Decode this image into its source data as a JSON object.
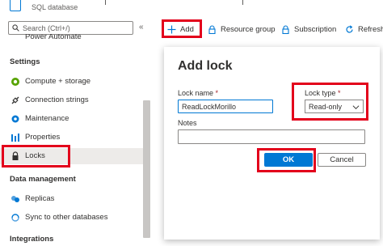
{
  "header": {
    "subtitle": "SQL database"
  },
  "sidebar": {
    "search_placeholder": "Search (Ctrl+/)",
    "collapse_glyph": "«",
    "partial_item": "Power Automate",
    "sections": [
      {
        "title": "Settings",
        "items": [
          {
            "label": "Compute + storage",
            "icon": "compute-icon"
          },
          {
            "label": "Connection strings",
            "icon": "connection-icon"
          },
          {
            "label": "Maintenance",
            "icon": "maintenance-icon"
          },
          {
            "label": "Properties",
            "icon": "properties-icon"
          },
          {
            "label": "Locks",
            "icon": "lock-icon",
            "selected": true
          }
        ]
      },
      {
        "title": "Data management",
        "items": [
          {
            "label": "Replicas",
            "icon": "replicas-icon"
          },
          {
            "label": "Sync to other databases",
            "icon": "sync-icon"
          }
        ]
      },
      {
        "title": "Integrations",
        "items": []
      }
    ]
  },
  "toolbar": {
    "add": "Add",
    "resource_group": "Resource group",
    "subscription": "Subscription",
    "refresh": "Refresh"
  },
  "panel": {
    "title": "Add lock",
    "lock_name_label": "Lock name",
    "lock_name_value": "ReadLockMorillo",
    "lock_type_label": "Lock type",
    "lock_type_value": "Read-only",
    "notes_label": "Notes",
    "notes_value": "",
    "required_mark": "*",
    "ok": "OK",
    "cancel": "Cancel"
  },
  "colors": {
    "accent": "#0078d4",
    "highlight": "#e3001b",
    "selected_bg": "#edebe9"
  }
}
